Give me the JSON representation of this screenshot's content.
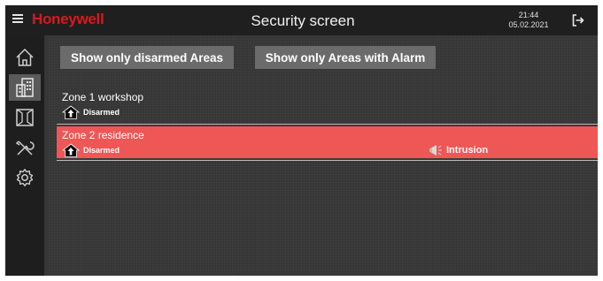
{
  "header": {
    "brand": "Honeywell",
    "title": "Security screen",
    "time": "21:44",
    "date": "05.02.2021",
    "menu_icon": "hamburger-icon",
    "logout_icon": "logout-icon"
  },
  "sidebar": {
    "items": [
      {
        "icon": "home-icon",
        "active": false
      },
      {
        "icon": "building-icon",
        "active": true
      },
      {
        "icon": "window-shutter-icon",
        "active": false
      },
      {
        "icon": "tools-icon",
        "active": false
      },
      {
        "icon": "gear-icon",
        "active": false
      }
    ]
  },
  "filters": {
    "disarmed_label": "Show only disarmed Areas",
    "alarm_label": "Show only Areas with Alarm"
  },
  "zones": [
    {
      "name": "Zone 1 workshop",
      "status": "Disarmed",
      "alarm": ""
    },
    {
      "name": "Zone 2 residence",
      "status": "Disarmed",
      "alarm": "Intrusion"
    }
  ],
  "colors": {
    "brand": "#d8191f",
    "alarm_row": "#ef5656",
    "background": "#363636",
    "sidebar": "#1e1e1e"
  }
}
